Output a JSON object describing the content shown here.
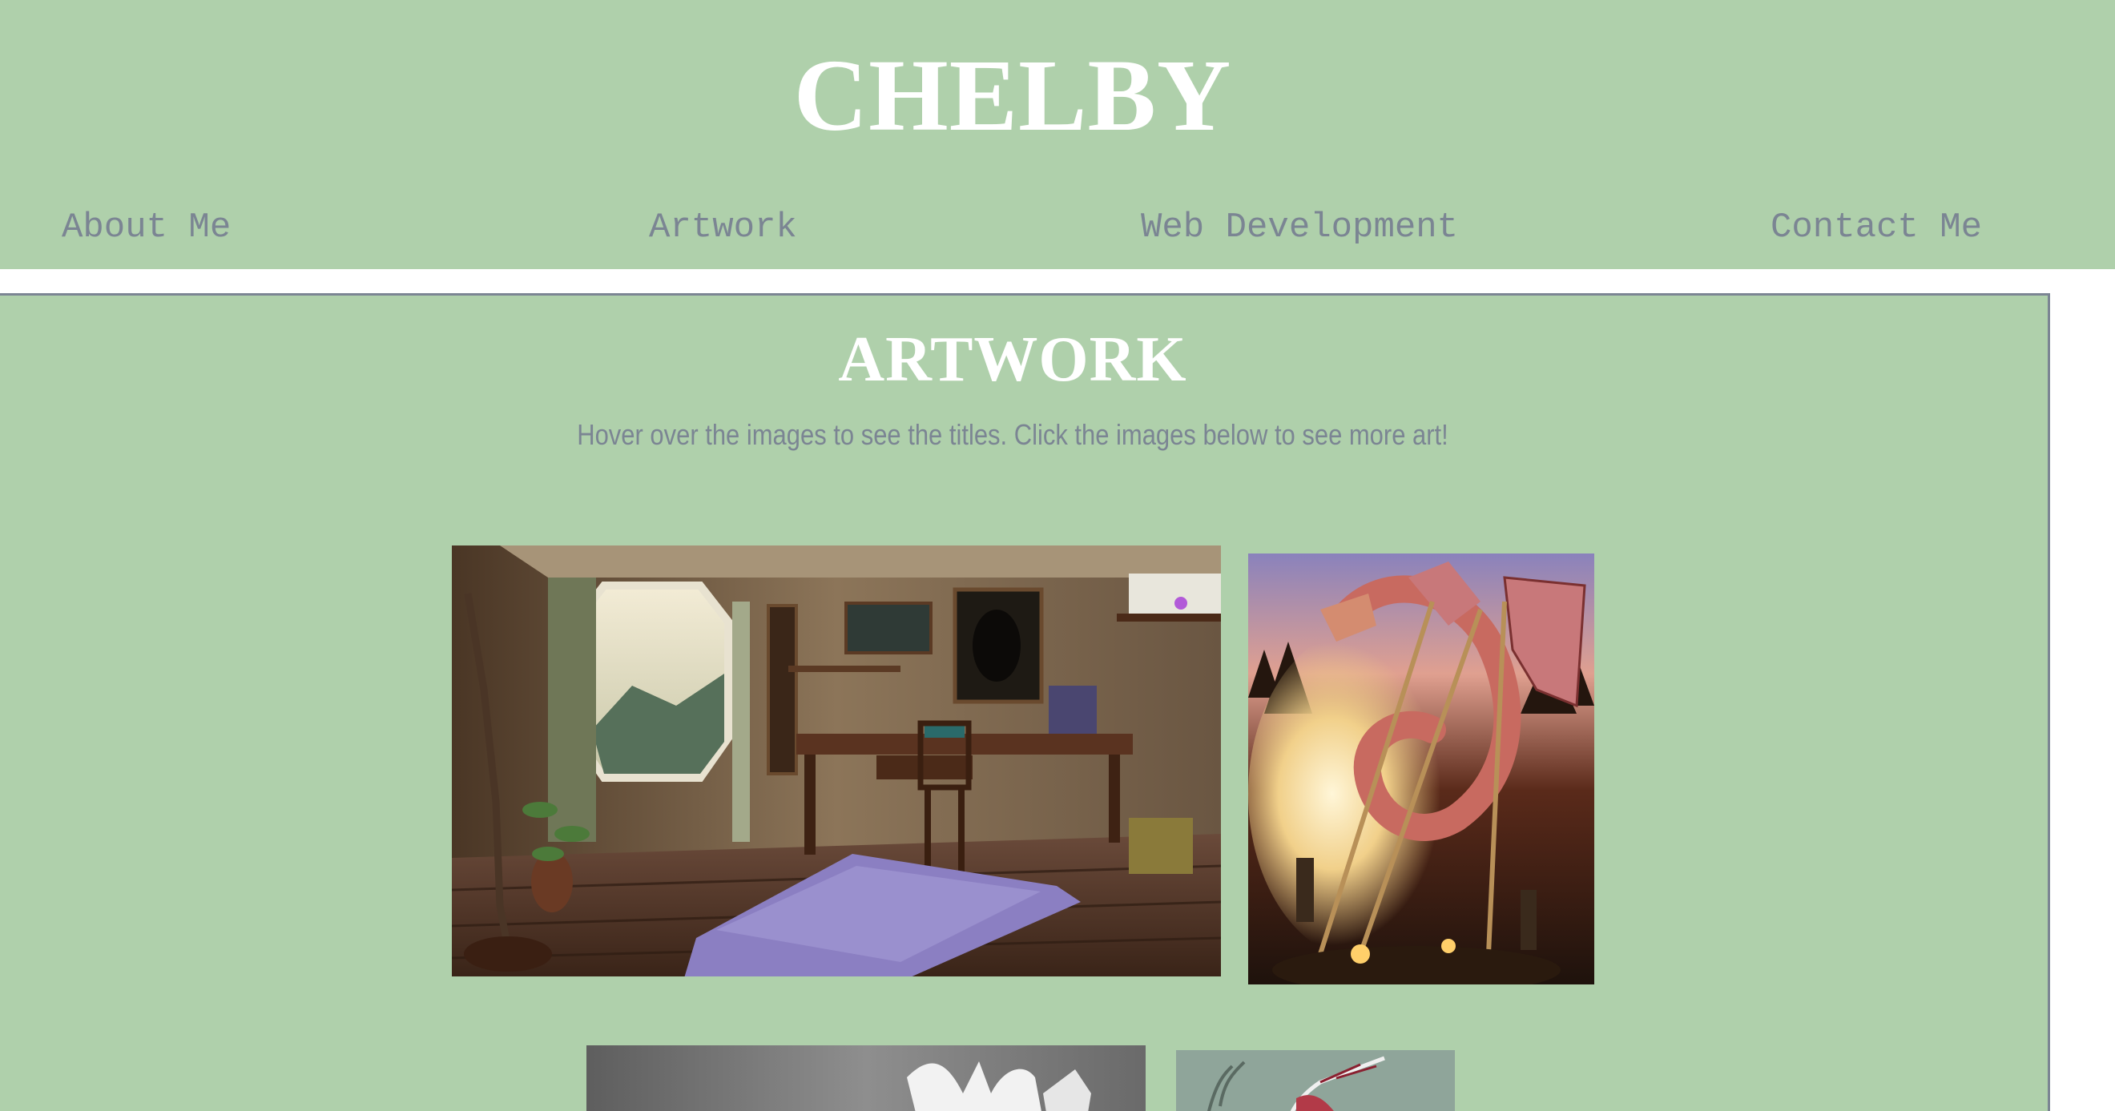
{
  "site": {
    "title": "CHELBY"
  },
  "nav": {
    "items": [
      {
        "label": "About Me"
      },
      {
        "label": "Artwork"
      },
      {
        "label": "Web Development"
      },
      {
        "label": "Contact Me"
      }
    ]
  },
  "main": {
    "heading": "ARTWORK",
    "instructions": "Hover over the images to see the titles. Click the images below to see more art!",
    "gallery": [
      {
        "icon": "room-interior-artwork-image"
      },
      {
        "icon": "dragon-artwork-image"
      },
      {
        "icon": "grayscale-artwork-image"
      },
      {
        "icon": "sketch-artwork-image"
      }
    ]
  },
  "colors": {
    "background": "#afd0ab",
    "accent_text": "#7b8593",
    "heading_text": "#ffffff",
    "border": "#7b8593"
  }
}
